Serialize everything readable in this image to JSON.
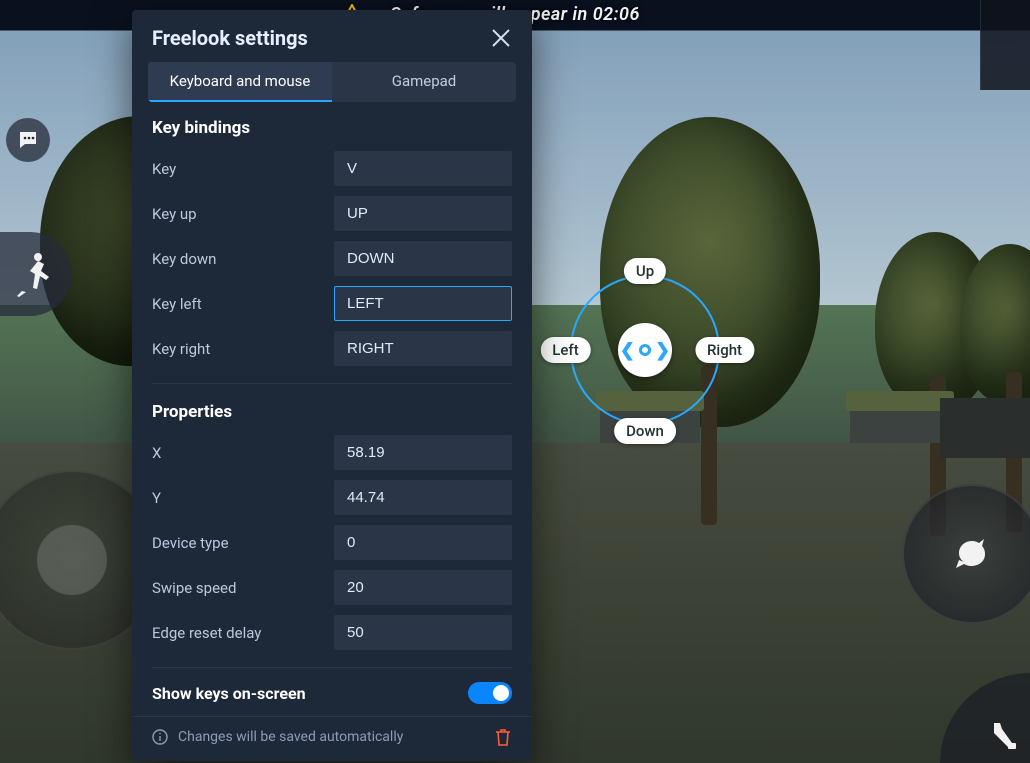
{
  "hud": {
    "safezone_text": "Safe zone will appear in 02:06"
  },
  "panel": {
    "title": "Freelook settings",
    "tabs": {
      "keyboard": "Keyboard and mouse",
      "gamepad": "Gamepad"
    },
    "active_tab": "keyboard",
    "key_bindings": {
      "title": "Key bindings",
      "rows": {
        "key": {
          "label": "Key",
          "value": "V"
        },
        "key_up": {
          "label": "Key up",
          "value": "UP"
        },
        "key_down": {
          "label": "Key down",
          "value": "DOWN"
        },
        "key_left": {
          "label": "Key left",
          "value": "LEFT",
          "highlighted": true
        },
        "key_right": {
          "label": "Key right",
          "value": "RIGHT"
        }
      }
    },
    "properties": {
      "title": "Properties",
      "rows": {
        "x": {
          "label": "X",
          "value": "58.19"
        },
        "y": {
          "label": "Y",
          "value": "44.74"
        },
        "device_type": {
          "label": "Device type",
          "value": "0"
        },
        "swipe_speed": {
          "label": "Swipe speed",
          "value": "20"
        },
        "edge_reset": {
          "label": "Edge reset delay",
          "value": "50"
        }
      }
    },
    "show_keys": {
      "label": "Show keys on-screen",
      "enabled": true
    },
    "footer_note": "Changes will be saved automatically"
  },
  "freelook_overlay": {
    "up": "Up",
    "down": "Down",
    "left": "Left",
    "right": "Right"
  },
  "colors": {
    "accent": "#2aa8ff",
    "panel_bg": "#1d2838",
    "input_bg": "#2a3548",
    "danger": "#ff5b3a"
  }
}
